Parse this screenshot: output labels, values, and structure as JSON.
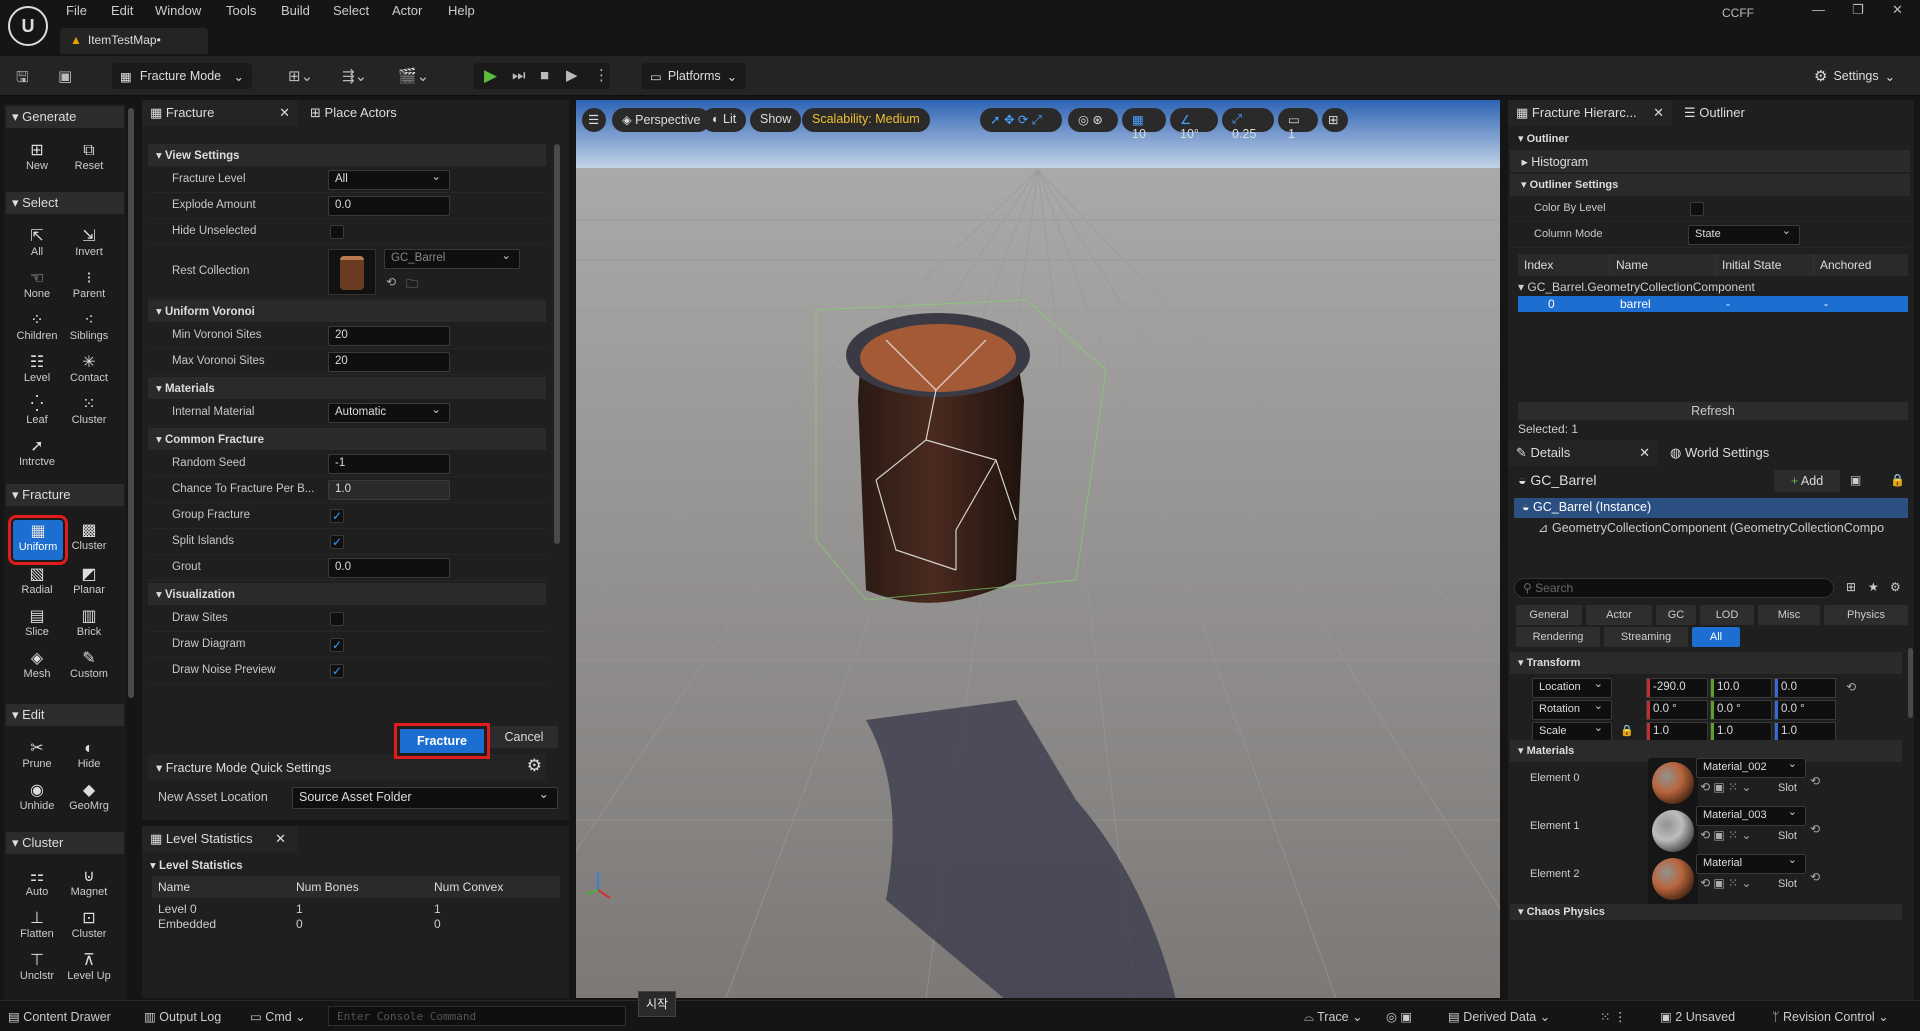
{
  "app": {
    "logo_text": "U",
    "doc_tab": "ItemTestMap•",
    "user": "CCFF"
  },
  "menu": [
    "File",
    "Edit",
    "Window",
    "Tools",
    "Build",
    "Select",
    "Actor",
    "Help"
  ],
  "toolbar": {
    "mode": "Fracture Mode",
    "platforms": "Platforms",
    "settings": "Settings"
  },
  "left_tools": {
    "generate": {
      "label": "Generate",
      "items": [
        "New",
        "Reset"
      ]
    },
    "select": {
      "label": "Select",
      "items": [
        "All",
        "Invert",
        "None",
        "Parent",
        "Children",
        "Siblings",
        "Level",
        "Contact",
        "Leaf",
        "Cluster",
        "Intrctve"
      ]
    },
    "fracture": {
      "label": "Fracture",
      "items": [
        "Uniform",
        "Cluster",
        "Radial",
        "Planar",
        "Slice",
        "Brick",
        "Mesh",
        "Custom"
      ]
    },
    "edit": {
      "label": "Edit",
      "items": [
        "Prune",
        "Hide",
        "Unhide",
        "GeoMrg"
      ]
    },
    "cluster": {
      "label": "Cluster",
      "items": [
        "Auto",
        "Magnet",
        "Flatten",
        "Cluster",
        "Unclstr",
        "Level Up"
      ]
    }
  },
  "fracture_panel": {
    "tab": "Fracture",
    "tab2": "Place Actors",
    "view_settings": "View Settings",
    "fracture_level_label": "Fracture Level",
    "fracture_level": "All",
    "explode_label": "Explode Amount",
    "explode": "0.0",
    "hide_unselected_label": "Hide Unselected",
    "rest_collection_label": "Rest Collection",
    "rest_collection": "GC_Barrel",
    "uniform_voronoi": "Uniform Voronoi",
    "min_sites_label": "Min Voronoi Sites",
    "min_sites": "20",
    "max_sites_label": "Max Voronoi Sites",
    "max_sites": "20",
    "materials": "Materials",
    "internal_material_label": "Internal Material",
    "internal_material": "Automatic",
    "common_fracture": "Common Fracture",
    "random_seed_label": "Random Seed",
    "random_seed": "-1",
    "chance_label": "Chance To Fracture Per B...",
    "chance": "1.0",
    "group_fracture_label": "Group Fracture",
    "split_islands_label": "Split Islands",
    "grout_label": "Grout",
    "grout": "0.0",
    "visualization": "Visualization",
    "draw_sites_label": "Draw Sites",
    "draw_diagram_label": "Draw Diagram",
    "draw_noise_label": "Draw Noise Preview",
    "fracture_btn": "Fracture",
    "cancel_btn": "Cancel",
    "quick_settings": "Fracture Mode Quick Settings",
    "new_asset_label": "New Asset Location",
    "new_asset": "Source Asset Folder"
  },
  "level_stats": {
    "tab": "Level Statistics",
    "section": "Level Statistics",
    "headers": [
      "Name",
      "Num Bones",
      "Num Convex"
    ],
    "rows": [
      [
        "Level 0",
        "1",
        "1"
      ],
      [
        "Embedded",
        "0",
        "0"
      ]
    ]
  },
  "viewport": {
    "perspective": "Perspective",
    "lit": "Lit",
    "show": "Show",
    "scalability": "Scalability: Medium",
    "grid": "10",
    "angle": "10°",
    "scale": "0.25",
    "camera": "1"
  },
  "hierarchy": {
    "tab": "Fracture Hierarc...",
    "tab2": "Outliner",
    "outliner": "Outliner",
    "histogram": "Histogram",
    "outliner_settings": "Outliner Settings",
    "color_by_level": "Color By Level",
    "column_mode_label": "Column Mode",
    "column_mode": "State",
    "headers": [
      "Index",
      "Name",
      "Initial State",
      "Anchored"
    ],
    "component": "GC_Barrel.GeometryCollectionComponent",
    "row": [
      "0",
      "barrel",
      "-",
      "-"
    ],
    "refresh": "Refresh",
    "selected": "Selected: 1"
  },
  "details": {
    "tab": "Details",
    "tab2": "World Settings",
    "actor": "GC_Barrel",
    "add": "Add",
    "instance": "GC_Barrel (Instance)",
    "component": "GeometryCollectionComponent (GeometryCollectionCompo",
    "search_placeholder": "Search",
    "filters1": [
      "General",
      "Actor",
      "GC",
      "LOD",
      "Misc",
      "Physics"
    ],
    "filters2": [
      "Rendering",
      "Streaming",
      "All"
    ],
    "transform": "Transform",
    "location": "Location",
    "loc": [
      "-290.0",
      "10.0",
      "0.0"
    ],
    "rotation": "Rotation",
    "rot": [
      "0.0 °",
      "0.0 °",
      "0.0 °"
    ],
    "scale": "Scale",
    "scl": [
      "1.0",
      "1.0",
      "1.0"
    ],
    "materials": "Materials",
    "elements": [
      {
        "label": "Element 0",
        "mat": "Material_002",
        "slot": "Slot",
        "color": "#b8653c"
      },
      {
        "label": "Element 1",
        "mat": "Material_003",
        "slot": "Slot",
        "color": "#bdbdbd"
      },
      {
        "label": "Element 2",
        "mat": "Material",
        "slot": "Slot",
        "color": "#b8653c"
      }
    ],
    "chaos": "Chaos Physics"
  },
  "status": {
    "content_drawer": "Content Drawer",
    "output_log": "Output Log",
    "cmd": "Cmd",
    "console_placeholder": "Enter Console Command",
    "tooltip": "시작",
    "trace": "Trace",
    "derived": "Derived Data",
    "unsaved": "2 Unsaved",
    "revision": "Revision Control"
  }
}
